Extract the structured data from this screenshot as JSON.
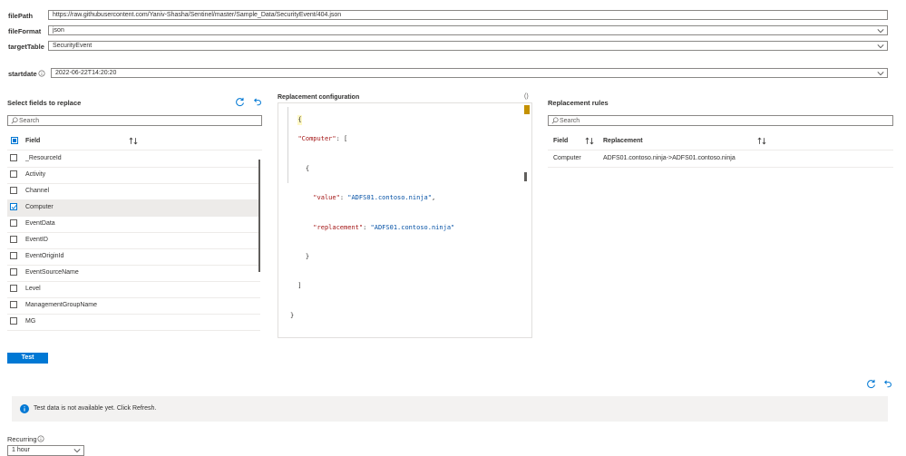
{
  "form": {
    "filePath_label": "filePath",
    "filePath_value": "https://raw.githubusercontent.com/Yaniv-Shasha/Sentinel/master/Sample_Data/SecurityEvent/404.json",
    "fileFormat_label": "fileFormat",
    "fileFormat_value": "json",
    "targetTable_label": "targetTable",
    "targetTable_value": "SecurityEvent",
    "startdate_label": "startdate",
    "startdate_value": "2022-06-22T14:20:20"
  },
  "fields_panel": {
    "title": "Select fields to replace",
    "search_placeholder": "Search",
    "header_field": "Field",
    "items": [
      {
        "label": "_ResourceId",
        "checked": false
      },
      {
        "label": "Activity",
        "checked": false
      },
      {
        "label": "Channel",
        "checked": false
      },
      {
        "label": "Computer",
        "checked": true
      },
      {
        "label": "EventData",
        "checked": false
      },
      {
        "label": "EventID",
        "checked": false
      },
      {
        "label": "EventOriginId",
        "checked": false
      },
      {
        "label": "EventSourceName",
        "checked": false
      },
      {
        "label": "Level",
        "checked": false
      },
      {
        "label": "ManagementGroupName",
        "checked": false
      },
      {
        "label": "MG",
        "checked": false
      }
    ]
  },
  "config_panel": {
    "title": "Replacement configuration",
    "braces_icon": "()",
    "code_lines": [
      "{",
      "  \"Computer\": [",
      "    {",
      "      \"value\": \"ADFS01.contoso.ninja\",",
      "      \"replacement\": \"ADFS01.contoso.ninja\"",
      "    }",
      "  ]",
      "}"
    ]
  },
  "rules_panel": {
    "title": "Replacement rules",
    "search_placeholder": "Search",
    "header_field": "Field",
    "header_replacement": "Replacement",
    "rows": [
      {
        "field": "Computer",
        "replacement": "ADFS01.contoso.ninja->ADFS01.contoso.ninja"
      }
    ]
  },
  "test_button": "Test",
  "info_message": "Test data is not available yet. Click Refresh.",
  "recurring": {
    "label": "Recurring",
    "value": "1 hour"
  },
  "colors": {
    "accent": "#0078d4",
    "border": "#8a8886",
    "selected_row": "#edebe9",
    "json_key": "#a31515",
    "json_string": "#0451a5"
  }
}
